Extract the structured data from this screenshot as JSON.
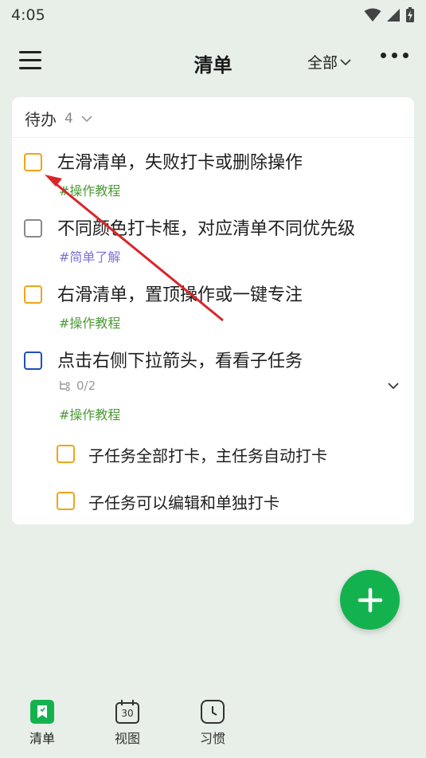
{
  "status_bar": {
    "time": "4:05"
  },
  "header": {
    "title": "清单",
    "filter": "全部"
  },
  "section": {
    "title": "待办",
    "count": "4"
  },
  "tasks": [
    {
      "title": "左滑清单，失败打卡或删除操作",
      "tag": "#操作教程"
    },
    {
      "title": "不同颜色打卡框，对应清单不同优先级",
      "tag": "#简单了解"
    },
    {
      "title": "右滑清单，置顶操作或一键专注",
      "tag": "#操作教程"
    },
    {
      "title": "点击右侧下拉箭头，看看子任务",
      "subtasks_progress": "0/2",
      "tag": "#操作教程"
    }
  ],
  "subtasks": [
    {
      "title": "子任务全部打卡，主任务自动打卡"
    },
    {
      "title": "子任务可以编辑和单独打卡"
    }
  ],
  "tab_bar": {
    "items": [
      {
        "label": "清单"
      },
      {
        "label": "视图",
        "icon_text": "30"
      },
      {
        "label": "习惯"
      }
    ]
  },
  "colors": {
    "accent": "#14b24f",
    "checkbox_orange": "#f0a41a",
    "checkbox_gray": "#8a8a8a",
    "checkbox_blue": "#1f4fb8",
    "tag_green": "#4c9a36",
    "tag_purple": "#7b72d6",
    "annotation_arrow": "#d8262b"
  }
}
